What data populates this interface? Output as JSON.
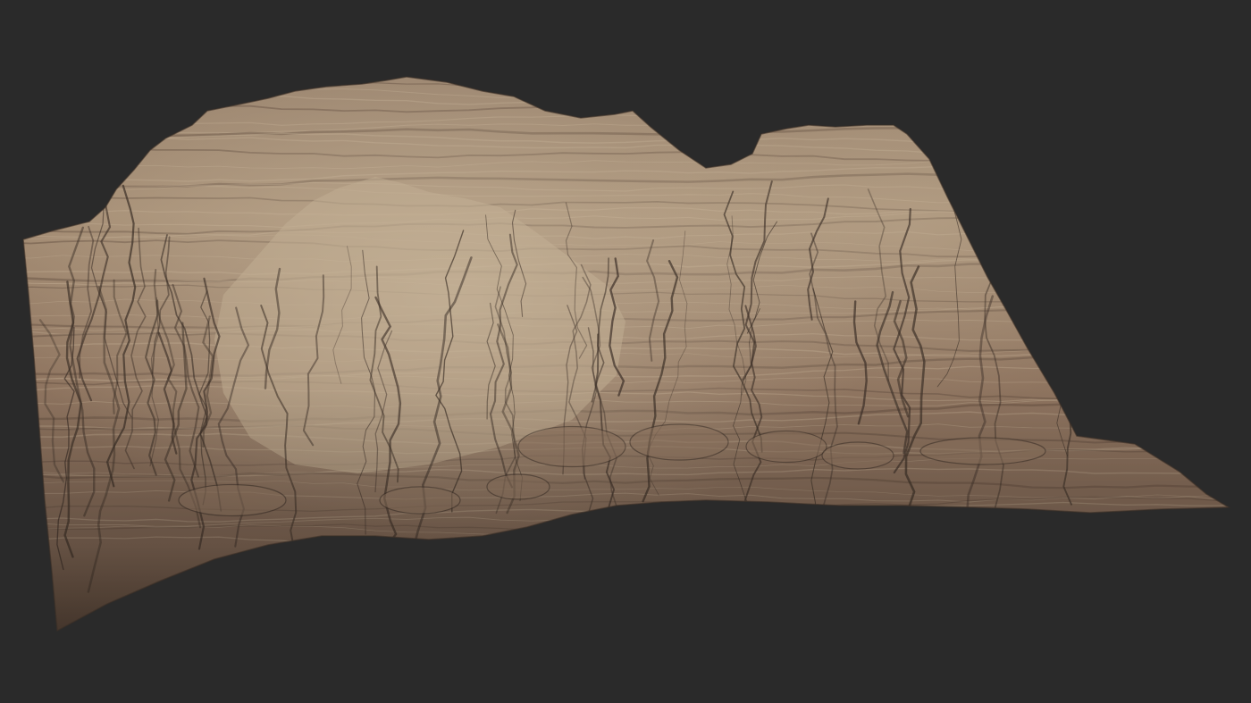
{
  "scene": {
    "background_color": "#2a2a2a",
    "subject": "terrain-mesh",
    "palette": {
      "rock_light": "#b49d82",
      "rock_mid": "#8f7560",
      "rock_dark": "#5e4a3c",
      "rock_shadow": "#3b2f27",
      "highlight": "#c9b79c"
    },
    "strata_count": 60,
    "gully_count": 70
  }
}
